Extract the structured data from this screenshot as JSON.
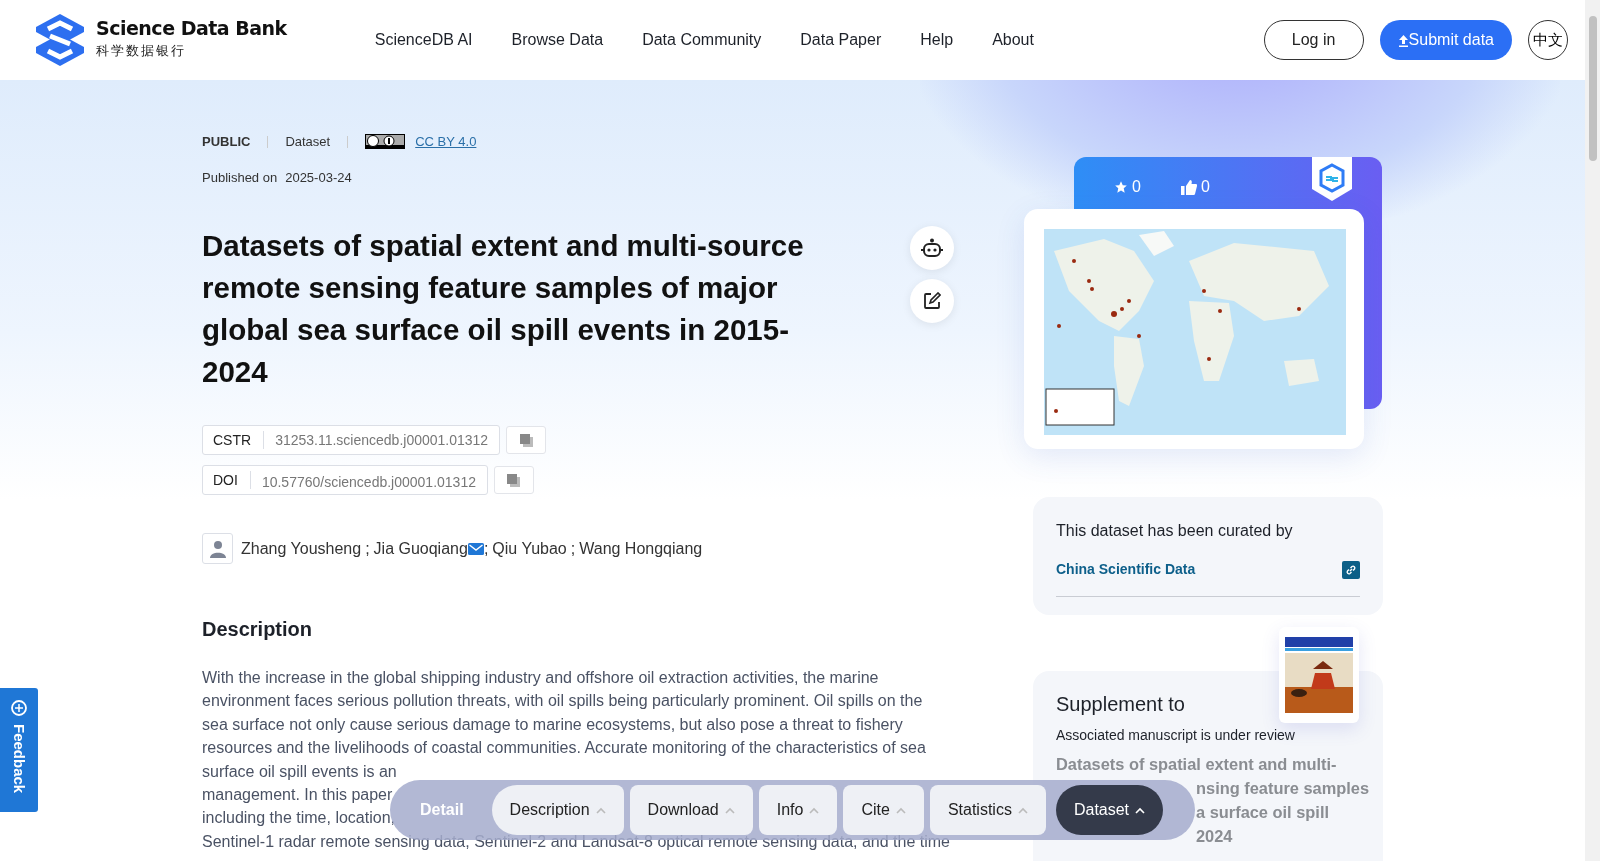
{
  "header": {
    "logo_title": "Science Data Bank",
    "logo_subtitle": "科学数据银行",
    "nav": [
      {
        "label": "ScienceDB AI"
      },
      {
        "label": "Browse Data"
      },
      {
        "label": "Data Community"
      },
      {
        "label": "Data Paper"
      },
      {
        "label": "Help"
      },
      {
        "label": "About"
      }
    ],
    "login": "Log in",
    "submit": "Submit data",
    "language": "中文"
  },
  "meta": {
    "access": "PUBLIC",
    "type": "Dataset",
    "license": "CC BY 4.0",
    "published_label": "Published on",
    "published_date": "2025-03-24"
  },
  "title": "Datasets of spatial extent and multi-source remote sensing feature samples of major global sea surface oil spill events in 2015-2024",
  "identifiers": [
    {
      "label": "CSTR",
      "value": "31253.11.sciencedb.j00001.01312"
    },
    {
      "label": "DOI",
      "value": "10.57760/sciencedb.j00001.01312"
    }
  ],
  "authors": [
    {
      "name": "Zhang Yousheng",
      "email": false,
      "separator": ";"
    },
    {
      "name": "Jia Guoqiang",
      "email": true,
      "separator": ";"
    },
    {
      "name": "Qiu Yubao",
      "email": false,
      "separator": ";"
    },
    {
      "name": "Wang Hongqiang",
      "email": false
    }
  ],
  "stats": {
    "favorites": "0",
    "likes": "0"
  },
  "description": {
    "heading": "Description",
    "lines": [
      "With the increase in the global shipping industry and offshore oil extraction activities, the marine",
      "environment faces serious pollution threats, with oil spills being particularly prominent. Oil spills on the",
      "sea surface not only cause serious damage to marine ecosystems, but also pose a threat to fishery",
      "resources and the livelihoods of coastal communities. Accurate monitoring of the characteristics of sea",
      "surface oil spill events is an",
      "management. In this paper",
      "including the time, location,",
      "Sentinel-1 radar remote sensing data, Sentinel-2 and Landsat-8 optical remote sensing data, and the time"
    ]
  },
  "curation": {
    "text": "This dataset has been curated by",
    "journal": "China Scientific Data"
  },
  "supplement": {
    "heading": "Supplement to",
    "status": "Associated manuscript is under review",
    "title_first_line": "Datasets of spatial extent and multi-",
    "title_fragments": [
      "nsing feature samples",
      "a surface oil spill",
      "2024"
    ]
  },
  "bottom_bar": {
    "label": "Detail",
    "tabs": [
      {
        "label": "Description",
        "selected": false
      },
      {
        "label": "Download",
        "selected": false
      },
      {
        "label": "Info",
        "selected": false
      },
      {
        "label": "Cite",
        "selected": false
      },
      {
        "label": "Statistics",
        "selected": false
      },
      {
        "label": "Dataset",
        "selected": true
      }
    ]
  },
  "feedback": "Feedback"
}
